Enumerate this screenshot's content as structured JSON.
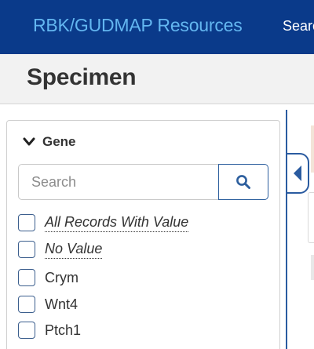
{
  "header": {
    "brand": "RBK/GUDMAP Resources",
    "nav_link": "Search"
  },
  "page": {
    "title": "Specimen"
  },
  "facet": {
    "title": "Gene",
    "chevron_icon": "chevron-down-icon",
    "search_placeholder": "Search",
    "search_value": "",
    "search_icon": "search-icon",
    "options": [
      {
        "label": "All Records With Value",
        "checked": false
      },
      {
        "label": "No Value",
        "checked": false
      },
      {
        "label": "Crym",
        "checked": false
      },
      {
        "label": "Wnt4",
        "checked": false
      },
      {
        "label": "Ptch1",
        "checked": false
      }
    ]
  },
  "sidebar_toggle_icon": "caret-left-icon",
  "colors": {
    "navbar": "#0a3a8a",
    "brand": "#63b6f0",
    "accent": "#2a5ba0"
  }
}
